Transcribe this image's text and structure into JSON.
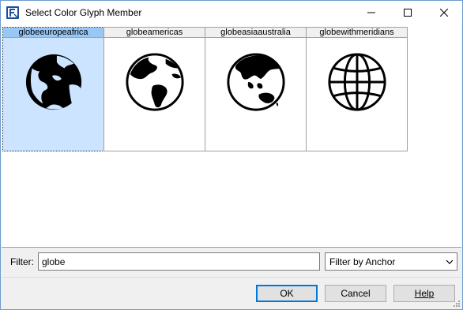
{
  "window": {
    "title": "Select Color Glyph Member",
    "app_icon": "font-app-icon",
    "controls": [
      "minimize-icon",
      "maximize-icon",
      "close-icon"
    ]
  },
  "glyphs": [
    {
      "label": "globeeuropeafrica",
      "icon": "globe-europe-africa-icon",
      "selected": true
    },
    {
      "label": "globeamericas",
      "icon": "globe-americas-icon",
      "selected": false
    },
    {
      "label": "globeasiaaustralia",
      "icon": "globe-asia-australia-icon",
      "selected": false
    },
    {
      "label": "globewithmeridians",
      "icon": "globe-with-meridians-icon",
      "selected": false
    }
  ],
  "filter": {
    "label": "Filter:",
    "value": "globe",
    "mode": "Filter by Anchor"
  },
  "buttons": {
    "ok": "OK",
    "cancel": "Cancel",
    "help": "Help"
  },
  "colors": {
    "selection_bg": "#cce4ff",
    "selection_header": "#99c7f5",
    "accent": "#0078d7",
    "border": "#a0a0a0"
  }
}
